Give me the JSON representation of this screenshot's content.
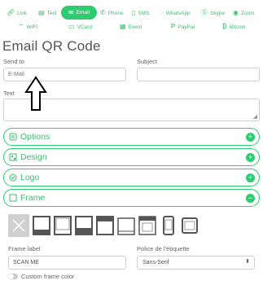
{
  "tabs": [
    {
      "label": "Link",
      "icon": "link-icon",
      "active": false
    },
    {
      "label": "Text",
      "icon": "text-icon",
      "active": false
    },
    {
      "label": "Email",
      "icon": "email-icon",
      "active": true
    },
    {
      "label": "Phone",
      "icon": "phone-icon",
      "active": false
    },
    {
      "label": "SMS",
      "icon": "sms-icon",
      "active": false
    },
    {
      "label": "WhatsApp",
      "icon": "whatsapp-icon",
      "active": false
    },
    {
      "label": "Skype",
      "icon": "skype-icon",
      "active": false
    },
    {
      "label": "Zoom",
      "icon": "zoom-icon",
      "active": false
    },
    {
      "label": "WIFI",
      "icon": "wifi-icon",
      "active": false
    },
    {
      "label": "VCard",
      "icon": "vcard-icon",
      "active": false
    },
    {
      "label": "Event",
      "icon": "calendar-icon",
      "active": false
    },
    {
      "label": "PayPal",
      "icon": "paypal-icon",
      "active": false
    },
    {
      "label": "Bitcoin",
      "icon": "bitcoin-icon",
      "active": false
    }
  ],
  "page_title": "Email QR Code",
  "form": {
    "send_to_label": "Send to",
    "send_to_placeholder": "E-Mail",
    "subject_label": "Subject",
    "subject_value": "",
    "text_label": "Text",
    "text_value": ""
  },
  "sections": [
    {
      "label": "Options",
      "icon": "options-icon",
      "toggle": "+"
    },
    {
      "label": "Design",
      "icon": "design-icon",
      "toggle": "+"
    },
    {
      "label": "Logo",
      "icon": "logo-icon",
      "toggle": "+"
    },
    {
      "label": "Frame",
      "icon": "frame-icon",
      "toggle": "−"
    }
  ],
  "frame_options": [
    "none",
    "frame-1",
    "frame-2",
    "frame-3",
    "frame-4",
    "frame-5",
    "frame-6",
    "phone-frame",
    "tablet-frame"
  ],
  "frame_label": {
    "label": "Frame label",
    "value": "SCAN ME"
  },
  "label_font": {
    "label": "Police de l'étiquette",
    "value": "Sans-Serif"
  },
  "custom_frame_color": {
    "label": "Custom frame color",
    "checked": false
  },
  "colors": {
    "accent": "#2ecc71"
  }
}
